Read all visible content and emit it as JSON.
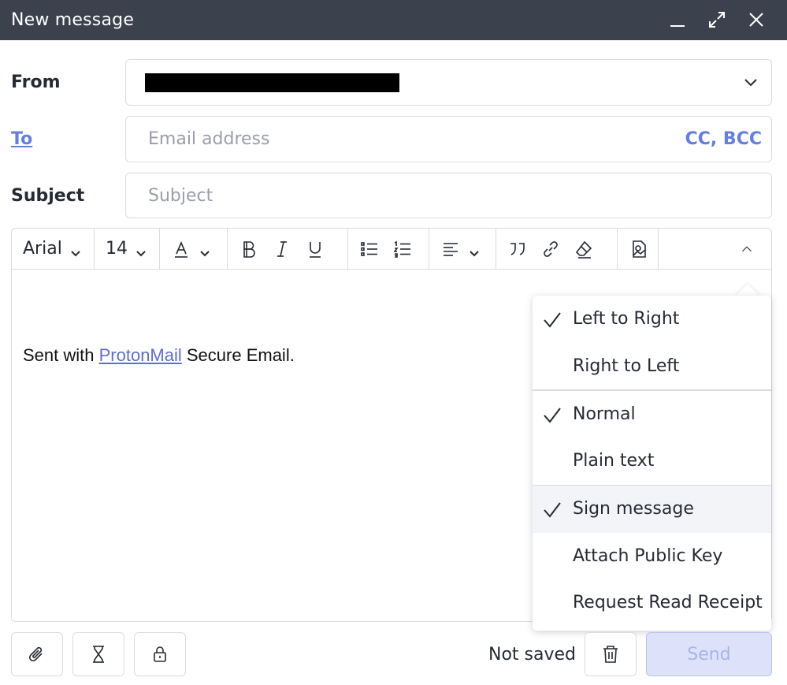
{
  "window": {
    "title": "New message"
  },
  "form": {
    "from_label": "From",
    "to_label": "To",
    "to_placeholder": "Email address",
    "cc_bcc": "CC, BCC",
    "subject_label": "Subject",
    "subject_placeholder": "Subject"
  },
  "toolbar": {
    "font": "Arial",
    "size": "14"
  },
  "body": {
    "prefix": "Sent with ",
    "link": "ProtonMail",
    "suffix": " Secure Email."
  },
  "menu": {
    "groups": [
      [
        {
          "label": "Left to Right",
          "checked": true
        },
        {
          "label": "Right to Left",
          "checked": false
        }
      ],
      [
        {
          "label": "Normal",
          "checked": true
        },
        {
          "label": "Plain text",
          "checked": false
        }
      ],
      [
        {
          "label": "Sign message",
          "checked": true
        },
        {
          "label": "Attach Public Key",
          "checked": false
        },
        {
          "label": "Request Read Receipt",
          "checked": false
        }
      ]
    ]
  },
  "footer": {
    "status": "Not saved",
    "send_label": "Send"
  }
}
